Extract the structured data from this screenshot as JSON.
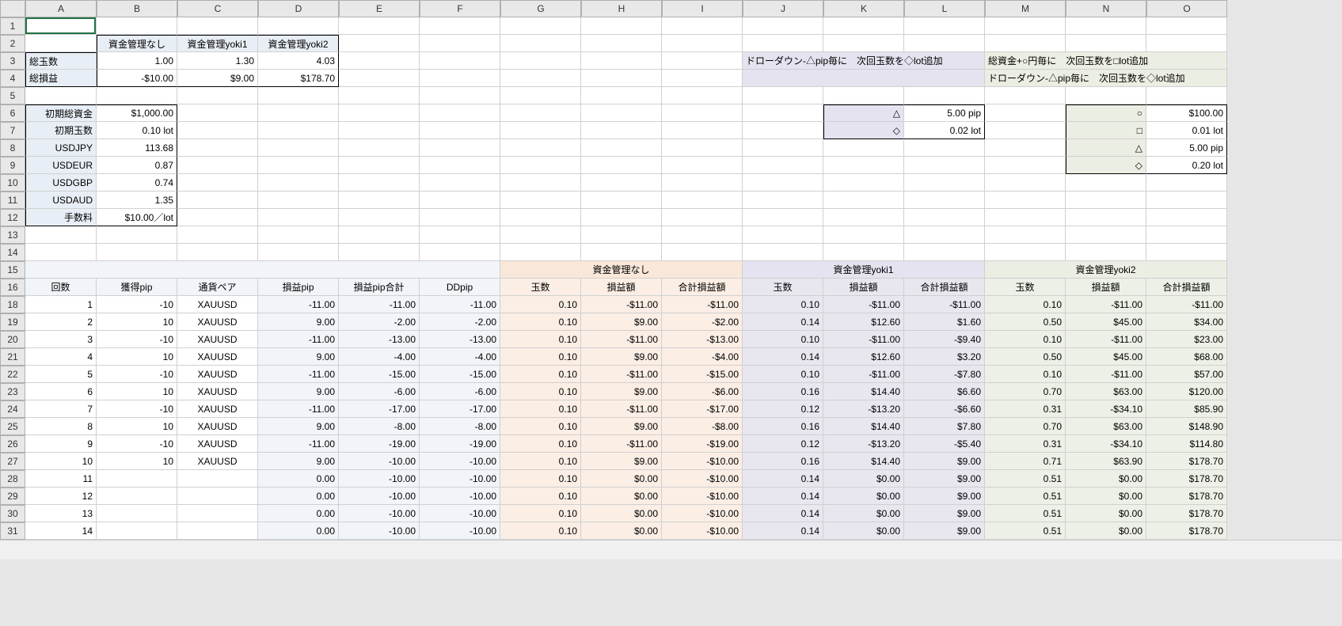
{
  "cols": [
    "A",
    "B",
    "C",
    "D",
    "E",
    "F",
    "G",
    "H",
    "I",
    "J",
    "K",
    "L",
    "M",
    "N",
    "O"
  ],
  "rows": [
    "1",
    "2",
    "3",
    "4",
    "5",
    "6",
    "7",
    "8",
    "9",
    "10",
    "11",
    "12",
    "13",
    "14",
    "15",
    "16",
    "18",
    "19",
    "20",
    "21",
    "22",
    "23",
    "24",
    "25",
    "26",
    "27",
    "28",
    "29",
    "30",
    "31"
  ],
  "hdr": {
    "b": "資金管理なし",
    "c": "資金管理yoki1",
    "d": "資金管理yoki2"
  },
  "sum": {
    "r3a": "総玉数",
    "r3b": "1.00",
    "r3c": "1.30",
    "r3d": "4.03",
    "r4a": "総損益",
    "r4b": "-$10.00",
    "r4c": "$9.00",
    "r4d": "$178.70"
  },
  "notes": {
    "n1": "ドローダウン-△pip毎に　次回玉数を◇lot追加",
    "n2": "総資金+○円毎に　次回玉数を□lot追加",
    "n3": "ドローダウン-△pip毎に　次回玉数を◇lot追加"
  },
  "params": {
    "p6a": "初期総資金",
    "p6b": "$1,000.00",
    "p7a": "初期玉数",
    "p7b": "0.10 lot",
    "p8a": "USDJPY",
    "p8b": "113.68",
    "p9a": "USDEUR",
    "p9b": "0.87",
    "p10a": "USDGBP",
    "p10b": "0.74",
    "p11a": "USDAUD",
    "p11b": "1.35",
    "p12a": "手数料",
    "p12b": "$10.00／lot"
  },
  "pbox": {
    "tri": "△",
    "triV": "5.00 pip",
    "dia": "◇",
    "diaV": "0.02 lot"
  },
  "gbox": {
    "cir": "○",
    "cirV": "$100.00",
    "sq": "□",
    "sqV": "0.01 lot",
    "tri": "△",
    "triV": "5.00 pip",
    "dia": "◇",
    "diaV": "0.20 lot"
  },
  "sections": {
    "s1": "資金管理なし",
    "s2": "資金管理yoki1",
    "s3": "資金管理yoki2"
  },
  "th": {
    "a": "回数",
    "b": "獲得pip",
    "c": "通貨ペア",
    "d": "損益pip",
    "e": "損益pip合計",
    "f": "DDpip",
    "g": "玉数",
    "h": "損益額",
    "i": "合計損益額",
    "j": "玉数",
    "k": "損益額",
    "l": "合計損益額",
    "m": "玉数",
    "n": "損益額",
    "o": "合計損益額"
  },
  "data": [
    {
      "a": "1",
      "b": "-10",
      "c": "XAUUSD",
      "d": "-11.00",
      "e": "-11.00",
      "f": "-11.00",
      "g": "0.10",
      "h": "-$11.00",
      "i": "-$11.00",
      "j": "0.10",
      "k": "-$11.00",
      "l": "-$11.00",
      "m": "0.10",
      "n": "-$11.00",
      "o": "-$11.00"
    },
    {
      "a": "2",
      "b": "10",
      "c": "XAUUSD",
      "d": "9.00",
      "e": "-2.00",
      "f": "-2.00",
      "g": "0.10",
      "h": "$9.00",
      "i": "-$2.00",
      "j": "0.14",
      "k": "$12.60",
      "l": "$1.60",
      "m": "0.50",
      "n": "$45.00",
      "o": "$34.00"
    },
    {
      "a": "3",
      "b": "-10",
      "c": "XAUUSD",
      "d": "-11.00",
      "e": "-13.00",
      "f": "-13.00",
      "g": "0.10",
      "h": "-$11.00",
      "i": "-$13.00",
      "j": "0.10",
      "k": "-$11.00",
      "l": "-$9.40",
      "m": "0.10",
      "n": "-$11.00",
      "o": "$23.00"
    },
    {
      "a": "4",
      "b": "10",
      "c": "XAUUSD",
      "d": "9.00",
      "e": "-4.00",
      "f": "-4.00",
      "g": "0.10",
      "h": "$9.00",
      "i": "-$4.00",
      "j": "0.14",
      "k": "$12.60",
      "l": "$3.20",
      "m": "0.50",
      "n": "$45.00",
      "o": "$68.00"
    },
    {
      "a": "5",
      "b": "-10",
      "c": "XAUUSD",
      "d": "-11.00",
      "e": "-15.00",
      "f": "-15.00",
      "g": "0.10",
      "h": "-$11.00",
      "i": "-$15.00",
      "j": "0.10",
      "k": "-$11.00",
      "l": "-$7.80",
      "m": "0.10",
      "n": "-$11.00",
      "o": "$57.00"
    },
    {
      "a": "6",
      "b": "10",
      "c": "XAUUSD",
      "d": "9.00",
      "e": "-6.00",
      "f": "-6.00",
      "g": "0.10",
      "h": "$9.00",
      "i": "-$6.00",
      "j": "0.16",
      "k": "$14.40",
      "l": "$6.60",
      "m": "0.70",
      "n": "$63.00",
      "o": "$120.00"
    },
    {
      "a": "7",
      "b": "-10",
      "c": "XAUUSD",
      "d": "-11.00",
      "e": "-17.00",
      "f": "-17.00",
      "g": "0.10",
      "h": "-$11.00",
      "i": "-$17.00",
      "j": "0.12",
      "k": "-$13.20",
      "l": "-$6.60",
      "m": "0.31",
      "n": "-$34.10",
      "o": "$85.90"
    },
    {
      "a": "8",
      "b": "10",
      "c": "XAUUSD",
      "d": "9.00",
      "e": "-8.00",
      "f": "-8.00",
      "g": "0.10",
      "h": "$9.00",
      "i": "-$8.00",
      "j": "0.16",
      "k": "$14.40",
      "l": "$7.80",
      "m": "0.70",
      "n": "$63.00",
      "o": "$148.90"
    },
    {
      "a": "9",
      "b": "-10",
      "c": "XAUUSD",
      "d": "-11.00",
      "e": "-19.00",
      "f": "-19.00",
      "g": "0.10",
      "h": "-$11.00",
      "i": "-$19.00",
      "j": "0.12",
      "k": "-$13.20",
      "l": "-$5.40",
      "m": "0.31",
      "n": "-$34.10",
      "o": "$114.80"
    },
    {
      "a": "10",
      "b": "10",
      "c": "XAUUSD",
      "d": "9.00",
      "e": "-10.00",
      "f": "-10.00",
      "g": "0.10",
      "h": "$9.00",
      "i": "-$10.00",
      "j": "0.16",
      "k": "$14.40",
      "l": "$9.00",
      "m": "0.71",
      "n": "$63.90",
      "o": "$178.70"
    },
    {
      "a": "11",
      "b": "",
      "c": "",
      "d": "0.00",
      "e": "-10.00",
      "f": "-10.00",
      "g": "0.10",
      "h": "$0.00",
      "i": "-$10.00",
      "j": "0.14",
      "k": "$0.00",
      "l": "$9.00",
      "m": "0.51",
      "n": "$0.00",
      "o": "$178.70"
    },
    {
      "a": "12",
      "b": "",
      "c": "",
      "d": "0.00",
      "e": "-10.00",
      "f": "-10.00",
      "g": "0.10",
      "h": "$0.00",
      "i": "-$10.00",
      "j": "0.14",
      "k": "$0.00",
      "l": "$9.00",
      "m": "0.51",
      "n": "$0.00",
      "o": "$178.70"
    },
    {
      "a": "13",
      "b": "",
      "c": "",
      "d": "0.00",
      "e": "-10.00",
      "f": "-10.00",
      "g": "0.10",
      "h": "$0.00",
      "i": "-$10.00",
      "j": "0.14",
      "k": "$0.00",
      "l": "$9.00",
      "m": "0.51",
      "n": "$0.00",
      "o": "$178.70"
    },
    {
      "a": "14",
      "b": "",
      "c": "",
      "d": "0.00",
      "e": "-10.00",
      "f": "-10.00",
      "g": "0.10",
      "h": "$0.00",
      "i": "-$10.00",
      "j": "0.14",
      "k": "$0.00",
      "l": "$9.00",
      "m": "0.51",
      "n": "$0.00",
      "o": "$178.70"
    }
  ]
}
